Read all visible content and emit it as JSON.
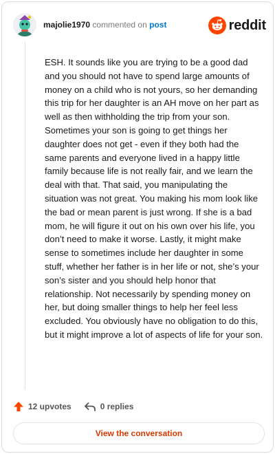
{
  "header": {
    "username": "majolie1970",
    "action_text": "commented on",
    "post_link": "post",
    "brand": "reddit"
  },
  "comment": {
    "body": "ESH. It sounds like you are trying to be a good dad and you should not have to spend large amounts of money on a child who is not yours, so her demanding this trip for her daughter is an AH move on her part as well as then withholding the trip from your son. Sometimes your son is going to get things her daughter does not get - even if they both had the same parents and everyone lived in a happy little family because life is not really fair, and we learn the deal with that. That said, you manipulating the situation was not great. You making his mom look like the bad or mean parent is just wrong. If she is a bad mom, he will figure it out on his own over his life, you don’t need to make it worse. Lastly, it might make sense to sometimes include her daughter in some stuff, whether her father is in her life or not, she’s your son’s sister and you should help honor that relationship. Not necessarily by spending money on her, but doing smaller things to help her feel less excluded. You obviously have no obligation to do this, but it might improve a lot of aspects of life for your son."
  },
  "footer": {
    "upvotes": "12 upvotes",
    "replies": "0 replies",
    "view_button": "View the conversation"
  },
  "colors": {
    "accent": "#ff4500",
    "link": "#0079d3",
    "button_text": "#d93a00"
  },
  "icons": {
    "avatar": "snoo-avatar",
    "brand_logo": "reddit-snoo-logo",
    "upvote": "upvote-arrow-icon",
    "reply": "reply-arrow-icon"
  }
}
